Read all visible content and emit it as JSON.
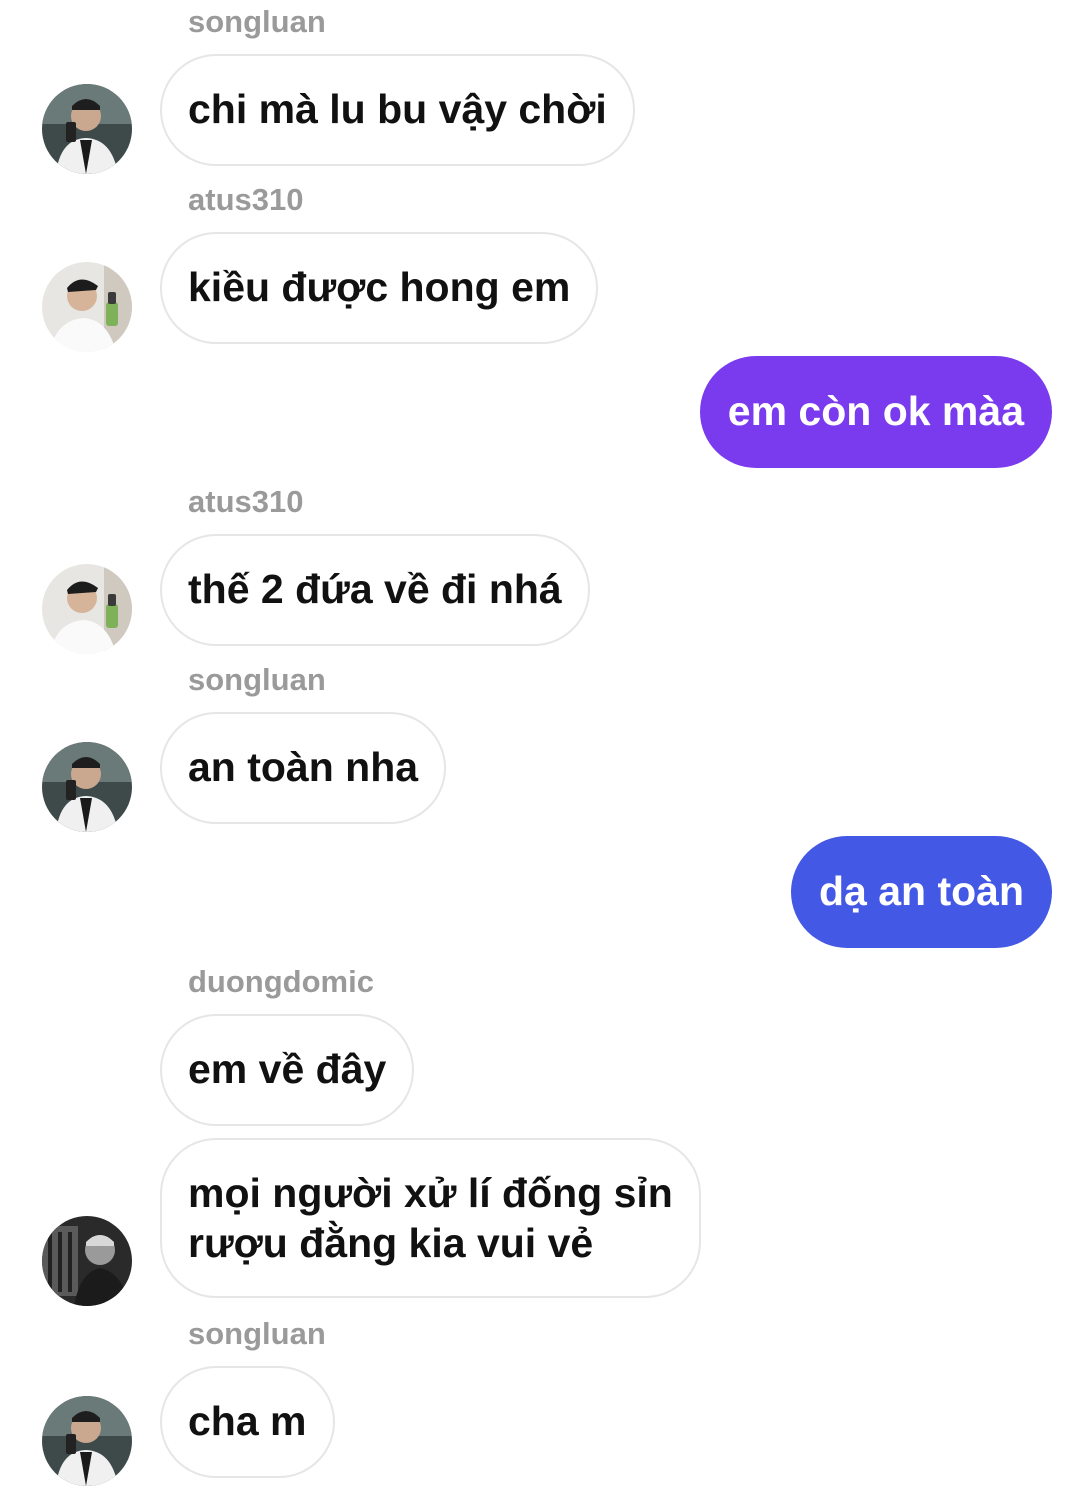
{
  "messages": [
    {
      "sender": "songluan",
      "text": "chi mà lu bu vậy chời"
    },
    {
      "sender": "atus310",
      "text": "kiều được hong em"
    },
    {
      "text": "em còn ok màa"
    },
    {
      "sender": "atus310",
      "text": "thế 2 đứa về đi nhá"
    },
    {
      "sender": "songluan",
      "text": "an toàn nha"
    },
    {
      "text": "dạ an toàn"
    },
    {
      "sender": "duongdomic",
      "text": "em về đây"
    },
    {
      "lines": [
        "mọi người xử lí đống sỉn",
        "rượu đằng kia vui vẻ"
      ]
    },
    {
      "sender": "songluan",
      "text": "cha m"
    }
  ],
  "colors": {
    "outgoing_1": "#7A3BEE",
    "outgoing_2": "#4458E6",
    "incoming_border": "#e6e6e6",
    "sender_text": "#9a9a9a"
  }
}
